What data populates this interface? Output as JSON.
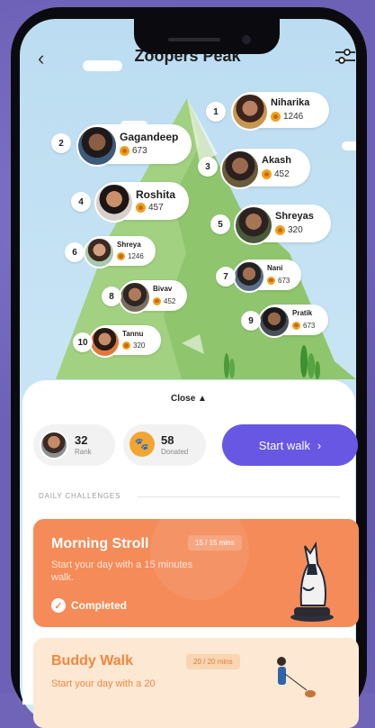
{
  "header": {
    "title": "Zoopers Peak",
    "back_icon": "chevron-left-icon",
    "filter_icon": "sliders-icon"
  },
  "leaderboard": [
    {
      "rank": "1",
      "name": "Niharika",
      "points": "1246"
    },
    {
      "rank": "2",
      "name": "Gagandeep",
      "points": "673"
    },
    {
      "rank": "3",
      "name": "Akash",
      "points": "452"
    },
    {
      "rank": "4",
      "name": "Roshita",
      "points": "457"
    },
    {
      "rank": "5",
      "name": "Shreyas",
      "points": "320"
    },
    {
      "rank": "6",
      "name": "Shreya",
      "points": "1246"
    },
    {
      "rank": "7",
      "name": "Nani",
      "points": "673"
    },
    {
      "rank": "8",
      "name": "Bivav",
      "points": "452"
    },
    {
      "rank": "9",
      "name": "Pratik",
      "points": "673"
    },
    {
      "rank": "10",
      "name": "Tannu",
      "points": "320"
    }
  ],
  "sheet": {
    "close_label": "Close",
    "rank": {
      "value": "32",
      "label": "Rank"
    },
    "donated": {
      "value": "58",
      "label": "Donated"
    },
    "start_walk": "Start walk",
    "section_title": "DAILY CHALLENGES"
  },
  "challenges": [
    {
      "title": "Morning Stroll",
      "badge": "15 / 15 mins",
      "desc": "Start your day with a 15 minutes walk.",
      "status": "Completed"
    },
    {
      "title": "Buddy Walk",
      "badge": "20 / 20 mins",
      "desc": "Start your day with a 20"
    }
  ],
  "colors": {
    "accent": "#6857e3",
    "card_completed": "#f48b59",
    "card_pending": "#fde8d3",
    "mountain": "#8cc56a"
  }
}
